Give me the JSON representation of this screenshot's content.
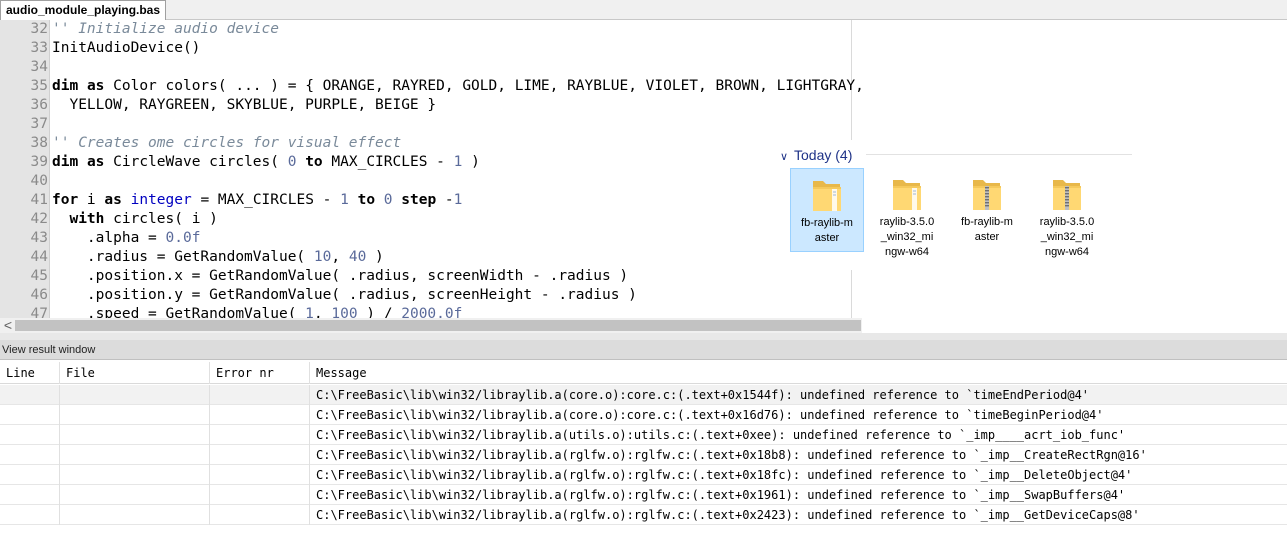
{
  "tab": {
    "title": "audio_module_playing.bas"
  },
  "editor": {
    "lines": [
      {
        "n": "32",
        "segments": [
          {
            "t": "'' Initialize audio device",
            "c": "cm"
          }
        ]
      },
      {
        "n": "33",
        "segments": [
          {
            "t": "InitAudioDevice()",
            "c": ""
          }
        ]
      },
      {
        "n": "34",
        "segments": [
          {
            "t": "",
            "c": ""
          }
        ]
      },
      {
        "n": "35",
        "segments": [
          {
            "t": "dim",
            "c": "kw"
          },
          {
            "t": " ",
            "c": ""
          },
          {
            "t": "as",
            "c": "kw"
          },
          {
            "t": " Color colors( ... ) = { ORANGE, RAYRED, GOLD, LIME, RAYBLUE, VIOLET, BROWN, LIGHTGRAY, PINK, _",
            "c": ""
          }
        ]
      },
      {
        "n": "36",
        "segments": [
          {
            "t": "  YELLOW, RAYGREEN, SKYBLUE, PURPLE, BEIGE }",
            "c": ""
          }
        ]
      },
      {
        "n": "37",
        "segments": [
          {
            "t": "",
            "c": ""
          }
        ]
      },
      {
        "n": "38",
        "segments": [
          {
            "t": "'' Creates ome circles for visual effect",
            "c": "cm"
          }
        ]
      },
      {
        "n": "39",
        "segments": [
          {
            "t": "dim",
            "c": "kw"
          },
          {
            "t": " ",
            "c": ""
          },
          {
            "t": "as",
            "c": "kw"
          },
          {
            "t": " CircleWave circles( ",
            "c": ""
          },
          {
            "t": "0",
            "c": "nm"
          },
          {
            "t": " ",
            "c": ""
          },
          {
            "t": "to",
            "c": "kw"
          },
          {
            "t": " MAX_CIRCLES - ",
            "c": ""
          },
          {
            "t": "1",
            "c": "nm"
          },
          {
            "t": " )",
            "c": ""
          }
        ]
      },
      {
        "n": "40",
        "segments": [
          {
            "t": "",
            "c": ""
          }
        ]
      },
      {
        "n": "41",
        "segments": [
          {
            "t": "for",
            "c": "kw"
          },
          {
            "t": " i ",
            "c": ""
          },
          {
            "t": "as",
            "c": "kw"
          },
          {
            "t": " ",
            "c": ""
          },
          {
            "t": "integer",
            "c": "ty"
          },
          {
            "t": " = MAX_CIRCLES - ",
            "c": ""
          },
          {
            "t": "1",
            "c": "nm"
          },
          {
            "t": " ",
            "c": ""
          },
          {
            "t": "to",
            "c": "kw"
          },
          {
            "t": " ",
            "c": ""
          },
          {
            "t": "0",
            "c": "nm"
          },
          {
            "t": " ",
            "c": ""
          },
          {
            "t": "step",
            "c": "kw"
          },
          {
            "t": " -",
            "c": ""
          },
          {
            "t": "1",
            "c": "nm"
          }
        ]
      },
      {
        "n": "42",
        "segments": [
          {
            "t": "  ",
            "c": ""
          },
          {
            "t": "with",
            "c": "kw"
          },
          {
            "t": " circles( i )",
            "c": ""
          }
        ]
      },
      {
        "n": "43",
        "segments": [
          {
            "t": "    .alpha = ",
            "c": ""
          },
          {
            "t": "0.0f",
            "c": "nm"
          }
        ]
      },
      {
        "n": "44",
        "segments": [
          {
            "t": "    .radius = GetRandomValue( ",
            "c": ""
          },
          {
            "t": "10",
            "c": "nm"
          },
          {
            "t": ", ",
            "c": ""
          },
          {
            "t": "40",
            "c": "nm"
          },
          {
            "t": " )",
            "c": ""
          }
        ]
      },
      {
        "n": "45",
        "segments": [
          {
            "t": "    .position.x = GetRandomValue( .radius, screenWidth - .radius )",
            "c": ""
          }
        ]
      },
      {
        "n": "46",
        "segments": [
          {
            "t": "    .position.y = GetRandomValue( .radius, screenHeight - .radius )",
            "c": ""
          }
        ]
      },
      {
        "n": "47",
        "segments": [
          {
            "t": "    .speed = GetRandomValue( ",
            "c": ""
          },
          {
            "t": "1",
            "c": "nm"
          },
          {
            "t": ", ",
            "c": ""
          },
          {
            "t": "100",
            "c": "nm"
          },
          {
            "t": " ) / ",
            "c": ""
          },
          {
            "t": "2000.0f",
            "c": "nm"
          }
        ]
      }
    ]
  },
  "scrollbar": {
    "left_arrow": "<"
  },
  "explorer": {
    "group_label": "Today (4)",
    "items": [
      {
        "label": "fb-raylib-m aster",
        "icon": "folder-icon",
        "selected": true
      },
      {
        "label": "raylib-3.5.0 _win32_mi ngw-w64",
        "icon": "folder-icon",
        "selected": false
      },
      {
        "label": "fb-raylib-m aster",
        "icon": "zip-folder-icon",
        "selected": false
      },
      {
        "label": "raylib-3.5.0 _win32_mi ngw-w64",
        "icon": "zip-folder-icon",
        "selected": false
      }
    ]
  },
  "results": {
    "title": "View result window",
    "columns": {
      "line": "Line",
      "file": "File",
      "error": "Error nr",
      "message": "Message"
    },
    "rows": [
      {
        "line": "",
        "file": "",
        "error": "",
        "message": "C:\\FreeBasic\\lib\\win32/libraylib.a(core.o):core.c:(.text+0x1544f): undefined reference to `timeEndPeriod@4'"
      },
      {
        "line": "",
        "file": "",
        "error": "",
        "message": "C:\\FreeBasic\\lib\\win32/libraylib.a(core.o):core.c:(.text+0x16d76): undefined reference to `timeBeginPeriod@4'"
      },
      {
        "line": "",
        "file": "",
        "error": "",
        "message": "C:\\FreeBasic\\lib\\win32/libraylib.a(utils.o):utils.c:(.text+0xee): undefined reference to `_imp____acrt_iob_func'"
      },
      {
        "line": "",
        "file": "",
        "error": "",
        "message": "C:\\FreeBasic\\lib\\win32/libraylib.a(rglfw.o):rglfw.c:(.text+0x18b8): undefined reference to `_imp__CreateRectRgn@16'"
      },
      {
        "line": "",
        "file": "",
        "error": "",
        "message": "C:\\FreeBasic\\lib\\win32/libraylib.a(rglfw.o):rglfw.c:(.text+0x18fc): undefined reference to `_imp__DeleteObject@4'"
      },
      {
        "line": "",
        "file": "",
        "error": "",
        "message": "C:\\FreeBasic\\lib\\win32/libraylib.a(rglfw.o):rglfw.c:(.text+0x1961): undefined reference to `_imp__SwapBuffers@4'"
      },
      {
        "line": "",
        "file": "",
        "error": "",
        "message": "C:\\FreeBasic\\lib\\win32/libraylib.a(rglfw.o):rglfw.c:(.text+0x2423): undefined reference to `_imp__GetDeviceCaps@8'"
      }
    ]
  }
}
